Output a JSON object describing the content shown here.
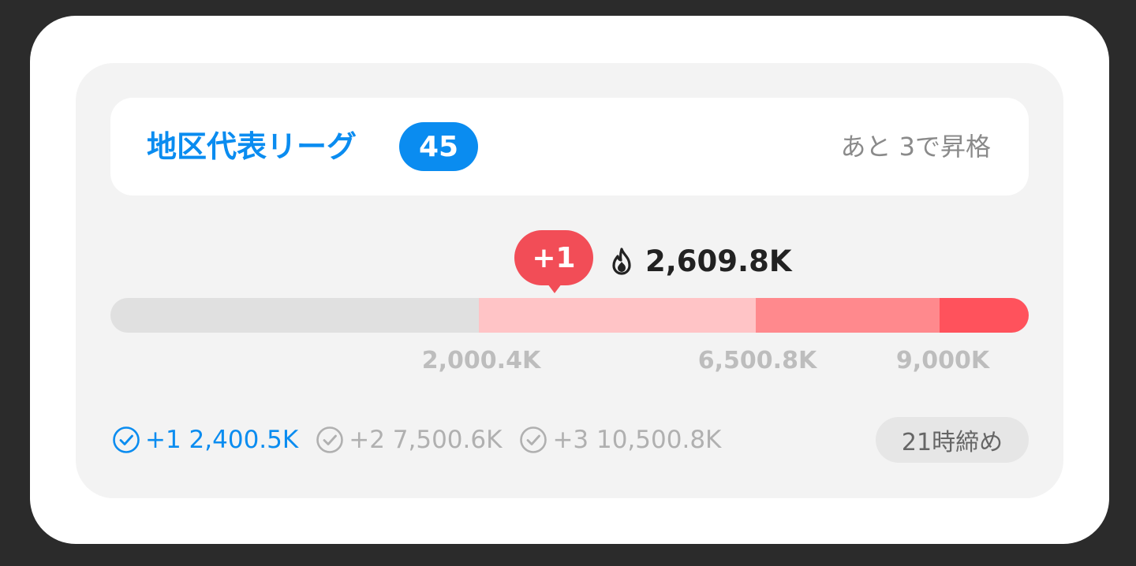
{
  "league": {
    "title": "地区代表リーグ",
    "rank": "45",
    "promotion_text": "あと 3で昇格"
  },
  "progress": {
    "gain_badge": "+1",
    "current_score": "2,609.8K",
    "score_icon": "flame-icon",
    "thresholds": [
      "2,000.4K",
      "6,500.8K",
      "9,000K"
    ]
  },
  "rewards": [
    {
      "label": "+1 2,400.5K",
      "icon": "check-circle-icon",
      "state": "active"
    },
    {
      "label": "+2 7,500.6K",
      "icon": "check-circle-icon",
      "state": "inactive"
    },
    {
      "label": "+3 10,500.8K",
      "icon": "check-circle-icon",
      "state": "inactive"
    }
  ],
  "deadline": "21時締め",
  "colors": {
    "accent_blue": "#0a8cf0",
    "bubble_red": "#f24d57",
    "segment_light": "#ffc4c6",
    "segment_mid": "#ff898d",
    "segment_strong": "#ff525c",
    "track_gray": "#e0e0e0"
  }
}
